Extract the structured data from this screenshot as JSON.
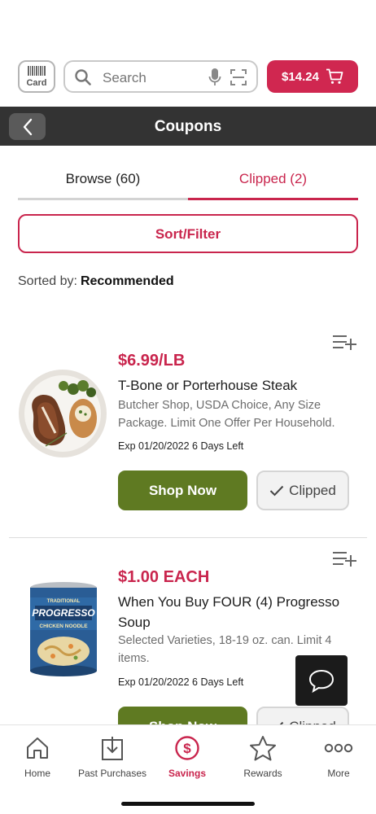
{
  "topbar": {
    "card_label": "Card",
    "search_placeholder": "Search",
    "cart_total": "$14.24"
  },
  "header": {
    "title": "Coupons"
  },
  "tabs": [
    {
      "label": "Browse (60)",
      "active": false
    },
    {
      "label": "Clipped (2)",
      "active": true
    }
  ],
  "sort_filter_label": "Sort/Filter",
  "sorted_by": {
    "label": "Sorted by:",
    "value": "Recommended"
  },
  "coupons": [
    {
      "price": "$6.99/LB",
      "name": "T-Bone or Porterhouse Steak",
      "description": "Butcher Shop, USDA Choice, Any Size Package. Limit One Offer Per Household.",
      "expiry": "Exp 01/20/2022 6 Days Left",
      "shop_label": "Shop Now",
      "clip_label": "Clipped"
    },
    {
      "price": "$1.00 EACH",
      "name": "When You Buy FOUR (4) Progresso Soup",
      "description": "Selected Varieties, 18-19 oz. can. Limit 4 items.",
      "expiry": "Exp 01/20/2022 6 Days Left",
      "shop_label": "Shop Now",
      "clip_label": "Clipped",
      "can_label": {
        "top": "TRADITIONAL",
        "brand": "PROGRESSO",
        "flavor": "CHICKEN NOODLE"
      }
    }
  ],
  "bottom_nav": [
    {
      "label": "Home",
      "icon": "home-icon",
      "active": false
    },
    {
      "label": "Past Purchases",
      "icon": "receipt-icon",
      "active": false
    },
    {
      "label": "Savings",
      "icon": "dollar-circle-icon",
      "active": true
    },
    {
      "label": "Rewards",
      "icon": "star-icon",
      "active": false
    },
    {
      "label": "More",
      "icon": "more-dots-icon",
      "active": false
    }
  ],
  "colors": {
    "brand": "#c9254d",
    "cart": "#d02750",
    "shop_button": "#5f7a22",
    "header": "#333333"
  }
}
